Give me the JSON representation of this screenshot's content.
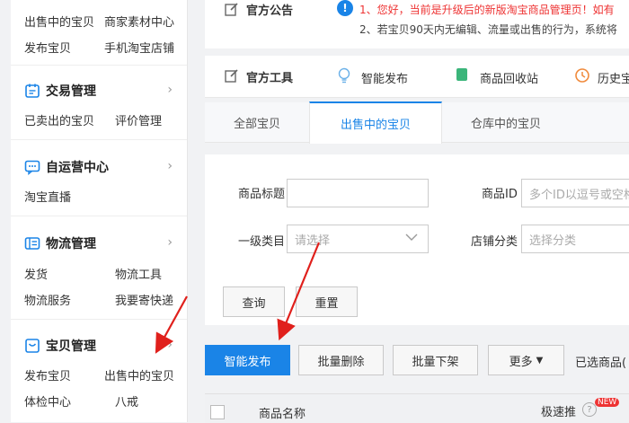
{
  "sidebar": {
    "top_links": [
      "出售中的宝贝",
      "商家素材中心",
      "发布宝贝",
      "手机淘宝店铺"
    ],
    "sections": [
      {
        "title": "交易管理",
        "links": [
          "已卖出的宝贝",
          "评价管理"
        ]
      },
      {
        "title": "自运营中心",
        "links": [
          "淘宝直播"
        ]
      },
      {
        "title": "物流管理",
        "links": [
          "发货",
          "物流工具",
          "物流服务",
          "我要寄快递"
        ]
      },
      {
        "title": "宝贝管理",
        "links": [
          "发布宝贝",
          "出售中的宝贝",
          "体检中心",
          "八戒"
        ]
      }
    ]
  },
  "notice": {
    "title": "官方公告",
    "line1": "1、您好，当前是升级后的新版淘宝商品管理页！如有",
    "line2": "2、若宝贝90天内无编辑、流量或出售的行为，系统将"
  },
  "tools": {
    "title": "官方工具",
    "items": [
      "智能发布",
      "商品回收站",
      "历史宝"
    ]
  },
  "tabs": [
    "全部宝贝",
    "出售中的宝贝",
    "仓库中的宝贝"
  ],
  "filter": {
    "title_label": "商品标题",
    "id_label": "商品ID",
    "id_placeholder": "多个ID以逗号或空格",
    "category_label": "一级类目",
    "category_placeholder": "请选择",
    "shop_cat_label": "店铺分类",
    "shop_cat_placeholder": "选择分类",
    "search_btn": "查询",
    "reset_btn": "重置"
  },
  "actions": {
    "smart_publish": "智能发布",
    "batch_delete": "批量删除",
    "batch_offshelf": "批量下架",
    "more": "更多",
    "selected": "已选商品("
  },
  "table": {
    "col_name": "商品名称",
    "col_speed": "极速推",
    "new_badge": "NEW"
  },
  "colors": {
    "accent": "#1a84e7",
    "alert": "#e33",
    "annotation": "#e0201c"
  }
}
